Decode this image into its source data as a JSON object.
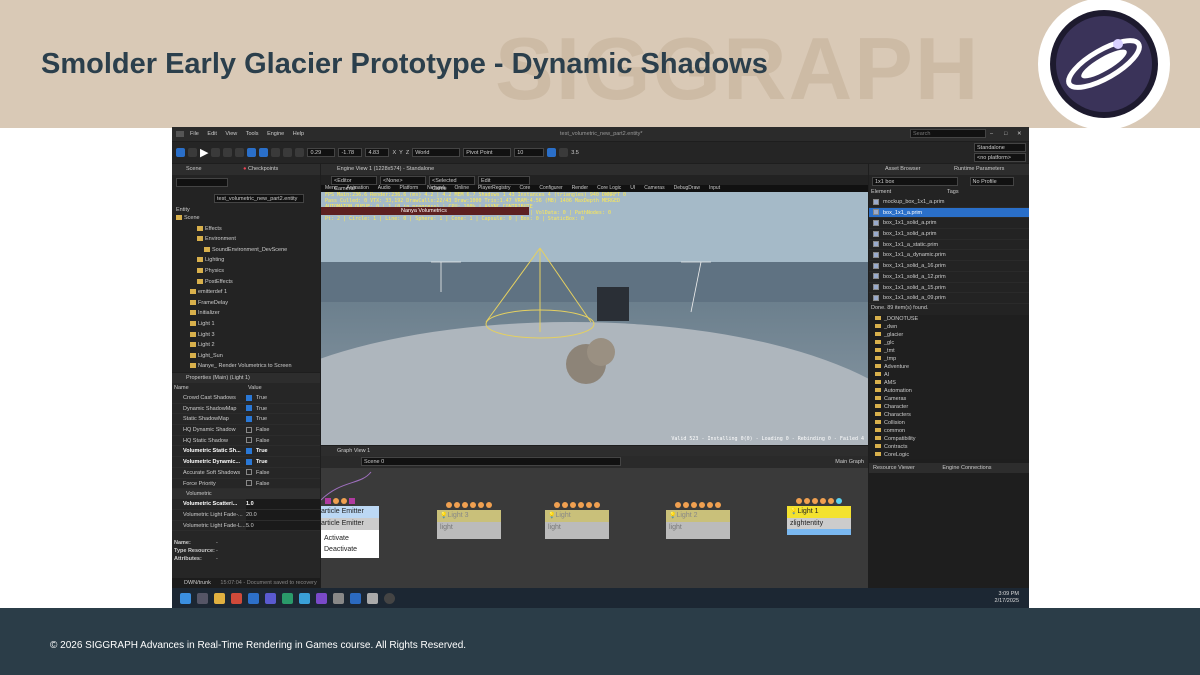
{
  "slide": {
    "title": "Smolder Early Glacier Prototype - Dynamic Shadows",
    "watermark": "SIGGRAPH",
    "footer": "© 2026 SIGGRAPH Advances in Real-Time Rendering in Games course. All Rights Reserved."
  },
  "app": {
    "menu": [
      "File",
      "Edit",
      "View",
      "Tools",
      "Engine",
      "Help"
    ],
    "doc_title": "test_volumetric_new_part2.entity*",
    "search_placeholder": "Search",
    "toolbar": {
      "x": "0.29",
      "y": "-1.78",
      "z": "4.83",
      "axes": [
        "X",
        "Y",
        "Z"
      ],
      "space": "World",
      "pivot": "Pivot Point",
      "snap": "10",
      "zoom": "3.5"
    },
    "platform": "Standalone",
    "platform2": "<no platform>",
    "scene_tab": "Scene",
    "checkpoints_tab": "Checkpoints",
    "entity_file": "test_volumetric_new_part2.entity",
    "entity_label": "Entity",
    "tree": [
      {
        "label": "Scene",
        "indent": 0
      },
      {
        "label": "Effects",
        "indent": 3
      },
      {
        "label": "Environment",
        "indent": 3
      },
      {
        "label": "SoundEnvironment_DevScene",
        "indent": 4
      },
      {
        "label": "Lighting",
        "indent": 3
      },
      {
        "label": "Physics",
        "indent": 3
      },
      {
        "label": "PostEffects",
        "indent": 3
      },
      {
        "label": "emitterdef 1",
        "indent": 2
      },
      {
        "label": "FrameDelay",
        "indent": 2
      },
      {
        "label": "Initializer",
        "indent": 2
      },
      {
        "label": "Light 1",
        "indent": 2
      },
      {
        "label": "Light 3",
        "indent": 2
      },
      {
        "label": "Light 2",
        "indent": 2
      },
      {
        "label": "Light_Sun",
        "indent": 2
      },
      {
        "label": "Nanye_ Render Volumetrics to Screen",
        "indent": 2
      }
    ],
    "properties": {
      "header": "Properties (Main) (Light 1)",
      "col_name": "Name",
      "col_value": "Value",
      "rows": [
        {
          "k": "Crowd Cast Shadows",
          "v": "True",
          "on": true,
          "bold": false
        },
        {
          "k": "Dynamic ShadowMap",
          "v": "True",
          "on": true,
          "bold": false
        },
        {
          "k": "Static ShadowMap",
          "v": "True",
          "on": true,
          "bold": false
        },
        {
          "k": "HQ Dynamic Shadow",
          "v": "False",
          "on": false,
          "bold": false
        },
        {
          "k": "HQ Static Shadow",
          "v": "False",
          "on": false,
          "bold": false
        },
        {
          "k": "Volumetric Static Sh...",
          "v": "True",
          "on": true,
          "bold": true
        },
        {
          "k": "Volumetric Dynamic...",
          "v": "True",
          "on": true,
          "bold": true
        },
        {
          "k": "Accurate Soft Shadows",
          "v": "False",
          "on": false,
          "bold": false
        },
        {
          "k": "Force Priority",
          "v": "False",
          "on": false,
          "bold": false
        }
      ],
      "section": "Volumetric",
      "rows2": [
        {
          "k": "Volumetric Scatteri...",
          "v": "1.0",
          "bold": true
        },
        {
          "k": "Volumetric Light Fade-...",
          "v": "20.0",
          "bold": false
        },
        {
          "k": "Volumetric Light Fade-L...",
          "v": "5.0",
          "bold": false
        }
      ],
      "info": [
        {
          "k": "Name:",
          "v": "-"
        },
        {
          "k": "Type Resource:",
          "v": "-"
        },
        {
          "k": "Attributes:",
          "v": "-"
        }
      ]
    },
    "status": {
      "branch": "DWN/trunk",
      "msg": "15:07:04 - Document saved to recovery"
    },
    "viewport": {
      "tab": "Engine View 1 (1228x574) - Standalone",
      "camera": "<Editor Camera>",
      "none": "<None>",
      "selected": "<Selected Came",
      "edit": "Edit",
      "menu": [
        "Menu",
        "Animation",
        "Audio",
        "Platform",
        "Network",
        "Online",
        "PlayerRegistry",
        "Core",
        "Configurer",
        "Render",
        "Core Logic",
        "UI",
        "Cameras",
        "DebugDraw",
        "Input"
      ],
      "stats1": "FPS Main:236.6 Render:236.6 (ms) 4.2 | 4.2 MEM 6.7 Shadows 1 43 Instances 4 (triangles) 940 DWNRFT 0",
      "stats2": "Pass Culled: 0 VTX: 33,192 DrawCalls:22/43 Draw:1000 Tris:1.47 VRAM:4.56 (MB) 1406 MaxDepth MERGED",
      "stats3": "AUTOMATON QUEUE: 0 | 1 (0 in progress) | CPU: 100% | ASYNC CONTRIBUTE",
      "stats4": "Lv1 Set: 15 | Tris: 15 | Raycast: 0 | Lines: 0 | Mesh: 0 | Light: 1 | VolData: 0 | PathNodes: 0",
      "stats5": "Pt: 2 | Circle: 1 | Line: 0 | Sphere: 1 | Cone: 1 | Capsule: 0 | Box: 0 | StaticBox: 0",
      "popup": "Nanya Volumetrics",
      "status": "Valid 523 - Installing 0(0) - Loading 0 - Rebinding 0 - Failed 4"
    },
    "graph": {
      "tab": "Graph View 1",
      "crumb": "Scene 0",
      "main": "Main Graph",
      "emitter": {
        "label1": "article Emitter",
        "label2": "article Emitter",
        "activate": "Activate",
        "deactivate": "Deactivate"
      },
      "nodes": [
        {
          "title": "Light 3",
          "sub": "light",
          "active": false
        },
        {
          "title": "Light",
          "sub": "light",
          "active": false
        },
        {
          "title": "Light 2",
          "sub": "light",
          "active": false
        },
        {
          "title": "Light 1",
          "sub": "zlightentity",
          "active": true
        }
      ]
    },
    "asset": {
      "tab": "Asset Browser",
      "runtime": "Runtime Parameters",
      "filter": "1x1 box",
      "profile": "No Profile",
      "col_el": "Element",
      "col_tags": "Tags",
      "items": [
        "mockup_box_1x1_a.prim",
        "box_1x1_a.prim",
        "box_1x1_solid_a.prim",
        "box_1x1_solid_a.prim",
        "box_1x1_a_static.prim",
        "box_1x1_a_dynamic.prim",
        "box_1x1_solid_a_16.prim",
        "box_1x1_solid_a_12.prim",
        "box_1x1_solid_a_15.prim",
        "box_1x1_solid_a_09.prim"
      ],
      "found": "Done. 89 item(s) found.",
      "folders": [
        "_DONOTUSE",
        "_dwn",
        "_glacier",
        "_glc",
        "_tmt",
        "_tmp",
        "Adventure",
        "AI",
        "AMS",
        "Automation",
        "Cameras",
        "Character",
        "Characters",
        "Collision",
        "common",
        "Compatibility",
        "Contracts",
        "CoreLogic"
      ],
      "rv": "Resource Viewer",
      "ec": "Engine Connections"
    },
    "clock": {
      "time": "3:09 PM",
      "date": "2/17/2025"
    },
    "colors": {
      "accent": "#2a78d6",
      "node_active": "#f3e22f"
    }
  }
}
